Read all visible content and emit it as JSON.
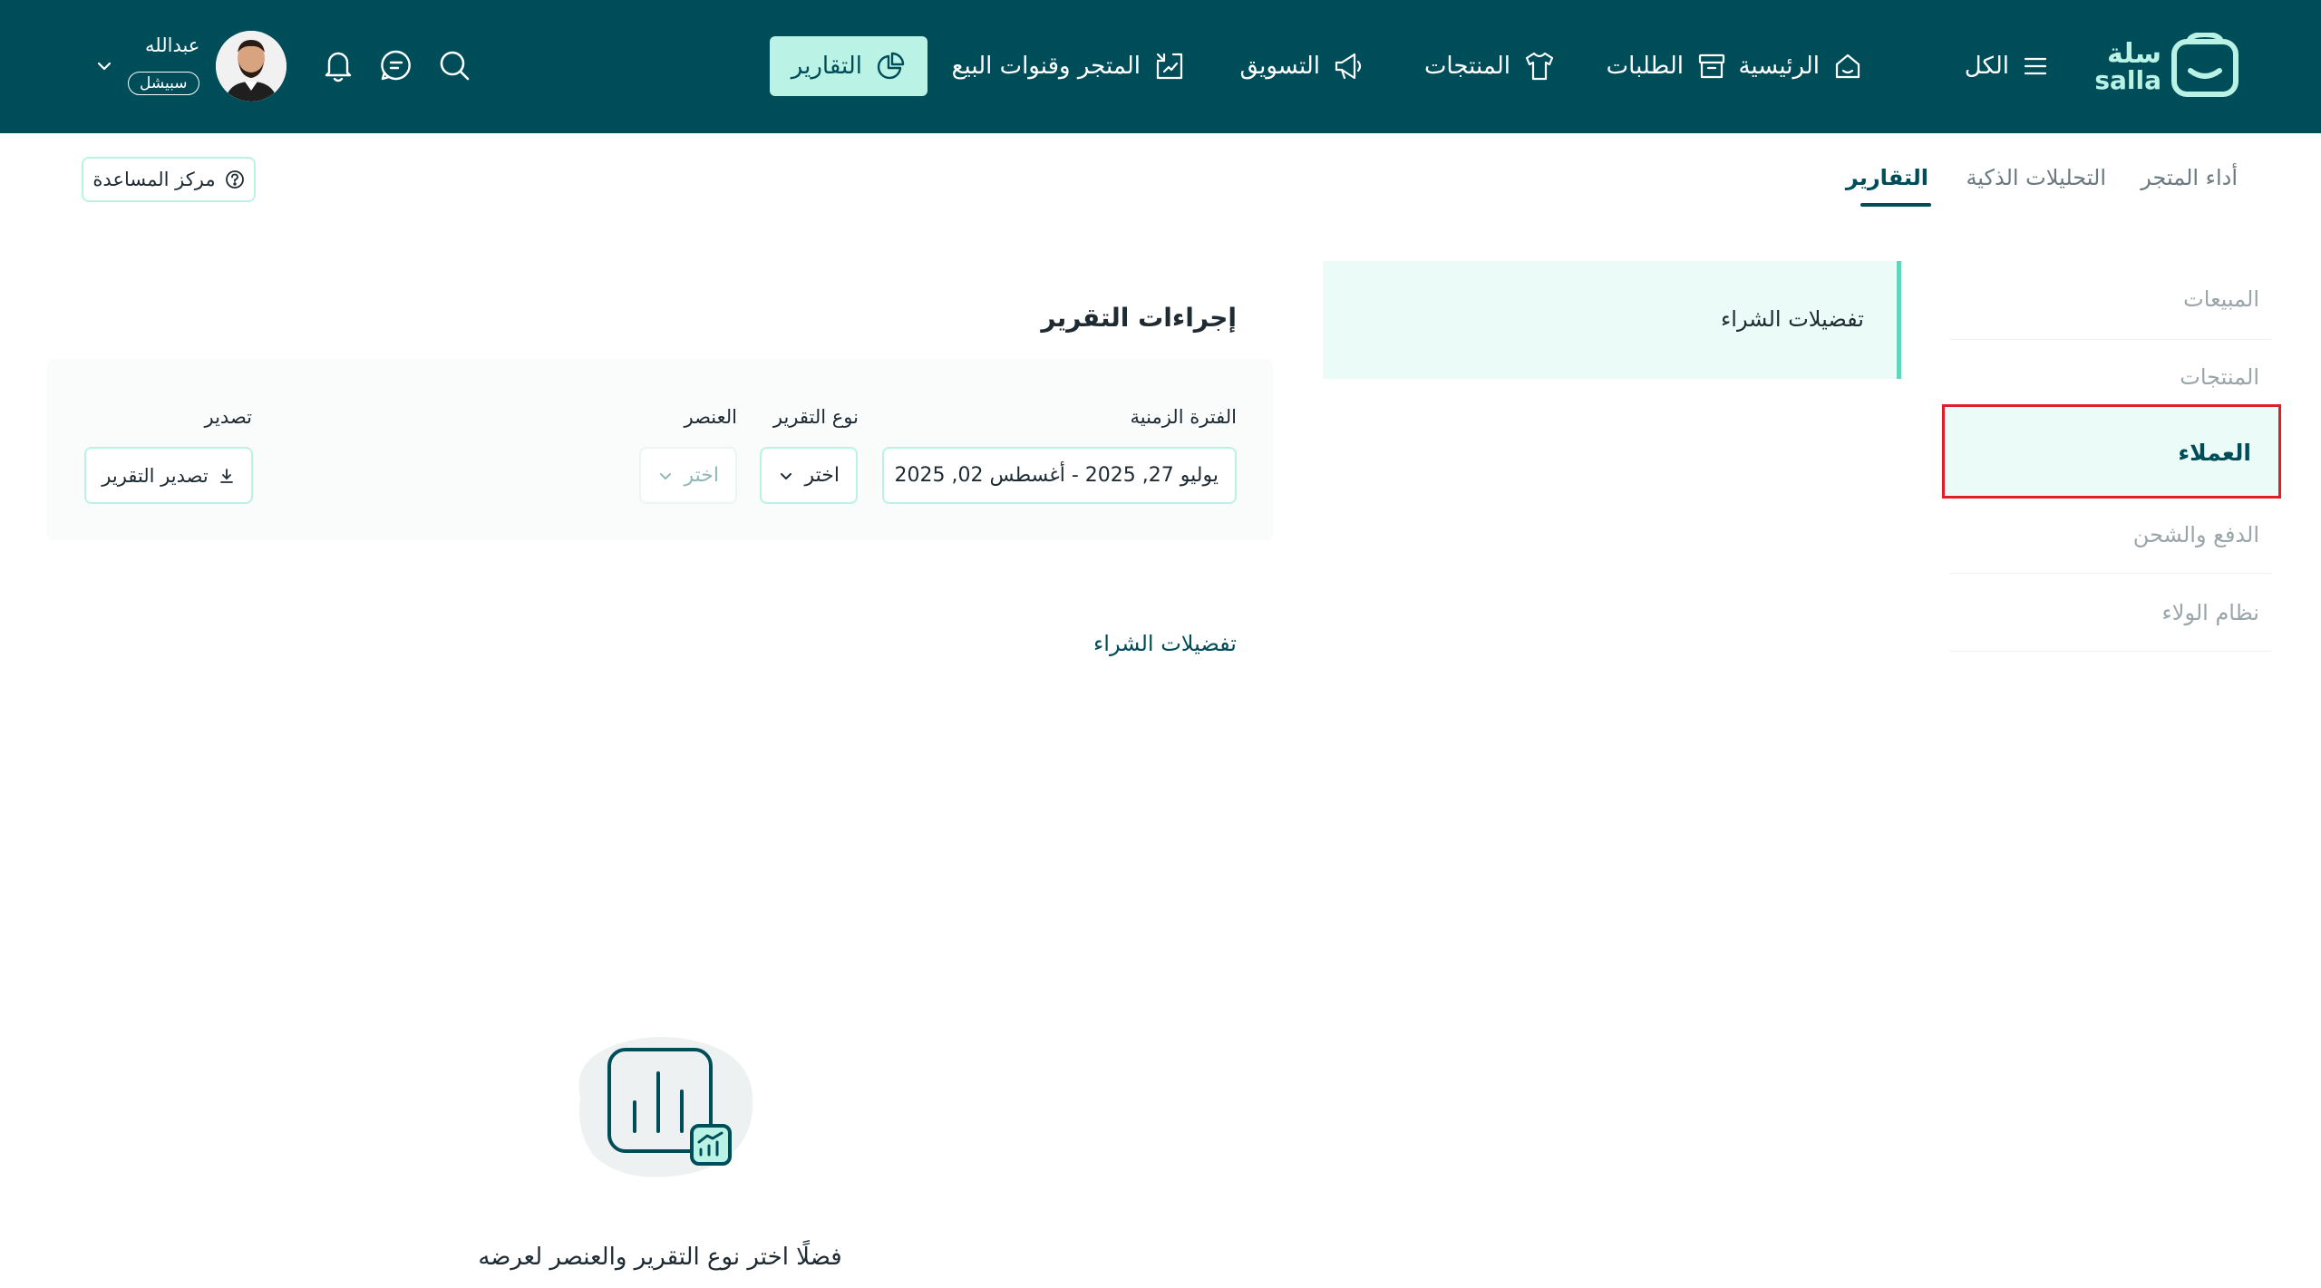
{
  "header": {
    "logo": {
      "arabic": "سلة",
      "latin": "salla"
    },
    "nav": [
      {
        "id": "all",
        "label": "الكل",
        "icon": "menu-icon"
      },
      {
        "id": "home",
        "label": "الرئيسية",
        "icon": "home-icon"
      },
      {
        "id": "orders",
        "label": "الطلبات",
        "icon": "archive-box-icon"
      },
      {
        "id": "products",
        "label": "المنتجات",
        "icon": "tshirt-icon"
      },
      {
        "id": "marketing",
        "label": "التسويق",
        "icon": "megaphone-icon"
      },
      {
        "id": "store",
        "label": "المتجر وقنوات البيع",
        "icon": "store-channels-icon"
      },
      {
        "id": "reports",
        "label": "التقارير",
        "icon": "pie-chart-icon",
        "active": true
      }
    ],
    "user": {
      "name": "عبدالله",
      "plan": "سبيشل"
    },
    "colors": {
      "bar": "#004d5a",
      "active_bg": "#baf3e6",
      "accent": "#5fd6bd"
    }
  },
  "tabs": [
    {
      "label": "أداء المتجر",
      "active": false
    },
    {
      "label": "التحليلات الذكية",
      "active": false
    },
    {
      "label": "التقارير",
      "active": true
    }
  ],
  "help_center": {
    "label": "مركز المساعدة"
  },
  "side_nav": {
    "items": [
      {
        "label": "المبيعات",
        "active": false
      },
      {
        "label": "المنتجات",
        "active": false
      },
      {
        "label": "العملاء",
        "active": true
      },
      {
        "label": "الدفع والشحن",
        "active": false
      },
      {
        "label": "نظام الولاء",
        "active": false
      }
    ],
    "highlight_color": "#e11d2a"
  },
  "subcategory": {
    "label": "تفضيلات الشراء"
  },
  "report_actions": {
    "title": "إجراءات التقرير",
    "period": {
      "label": "الفترة الزمنية",
      "value": "يوليو 27, 2025 - أغسطس 02, 2025"
    },
    "report_type": {
      "label": "نوع التقرير",
      "value": "اختر"
    },
    "element": {
      "label": "العنصر",
      "value": "اختر"
    },
    "export": {
      "label": "تصدير",
      "button": "تصدير التقرير"
    }
  },
  "section": {
    "title": "تفضيلات الشراء"
  },
  "empty_state": {
    "message": "فضلًا اختر نوع التقرير والعنصر لعرضه"
  }
}
